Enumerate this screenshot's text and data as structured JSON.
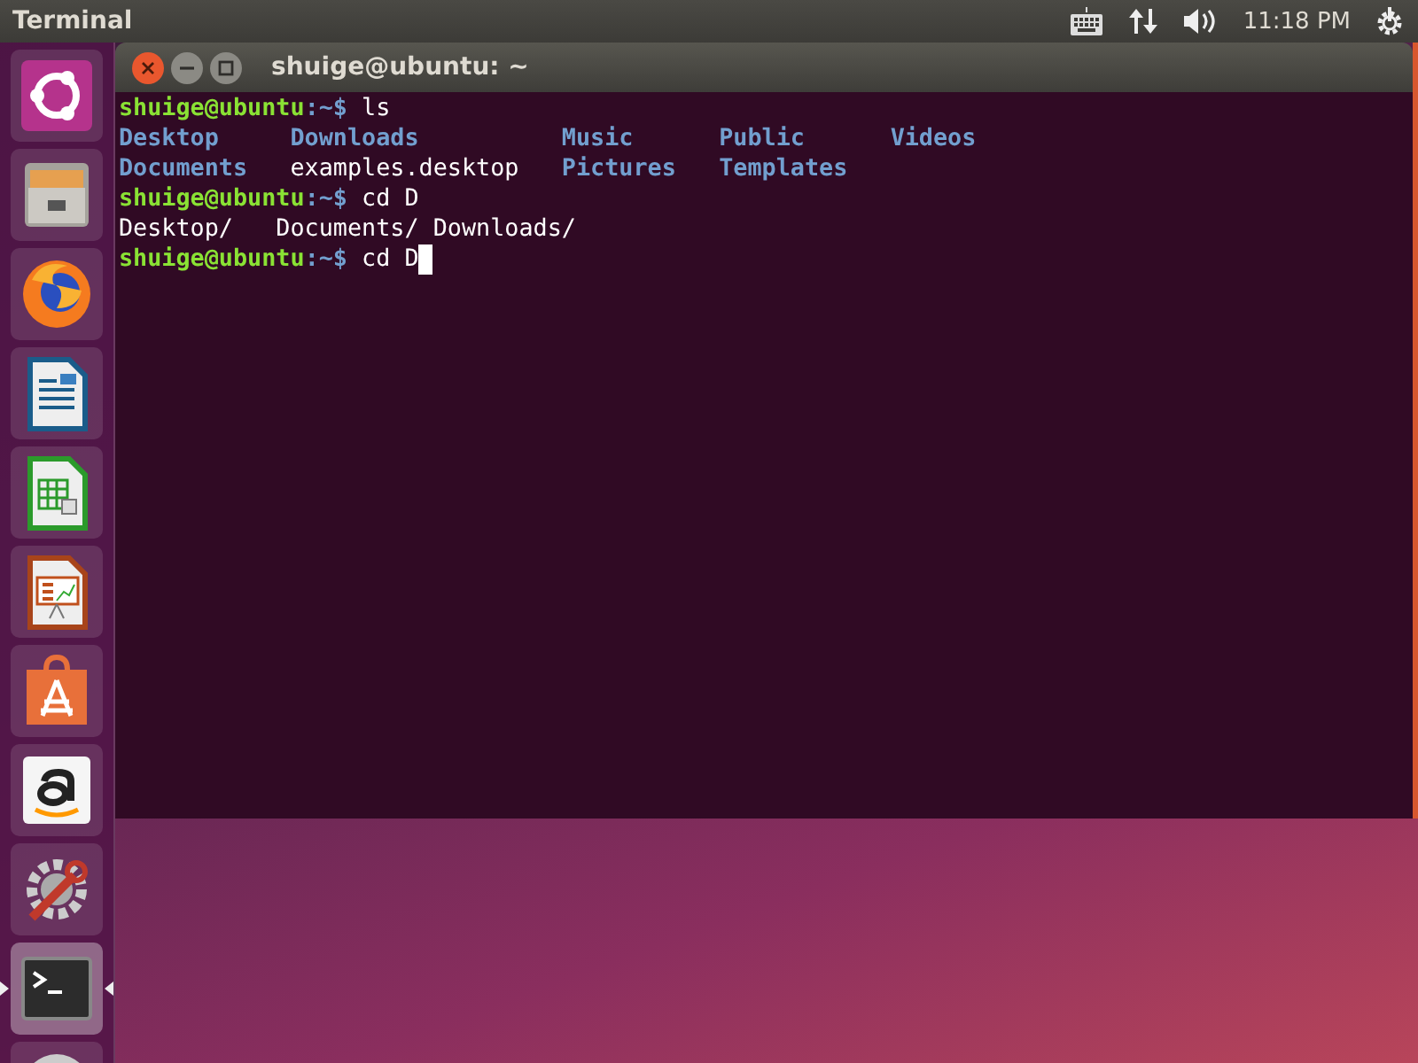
{
  "top_bar": {
    "app_title": "Terminal",
    "clock": "11:18 PM"
  },
  "launcher": {
    "items": [
      {
        "kind": "ubuntu",
        "active": false
      },
      {
        "kind": "files",
        "active": false
      },
      {
        "kind": "firefox",
        "active": false
      },
      {
        "kind": "writer",
        "active": false
      },
      {
        "kind": "calc",
        "active": false
      },
      {
        "kind": "impress",
        "active": false
      },
      {
        "kind": "store",
        "active": false
      },
      {
        "kind": "amazon",
        "active": false
      },
      {
        "kind": "settings",
        "active": false
      },
      {
        "kind": "terminal",
        "active": true
      },
      {
        "kind": "disc",
        "active": false
      }
    ]
  },
  "window": {
    "title": "shuige@ubuntu: ~",
    "lines": [
      {
        "kind": "prompt",
        "user": "shuige@ubuntu",
        "path": ":~$",
        "command": "ls",
        "cursor": false
      },
      {
        "kind": "listing",
        "entries": [
          {
            "name": "Desktop",
            "kind": "dir"
          },
          {
            "name": "Downloads",
            "kind": "dir"
          },
          {
            "name": "Music",
            "kind": "dir"
          },
          {
            "name": "Public",
            "kind": "dir"
          },
          {
            "name": "Videos",
            "kind": "dir"
          },
          {
            "name": "Documents",
            "kind": "dir"
          },
          {
            "name": "examples.desktop",
            "kind": "file"
          },
          {
            "name": "Pictures",
            "kind": "dir"
          },
          {
            "name": "Templates",
            "kind": "dir"
          }
        ]
      },
      {
        "kind": "prompt",
        "user": "shuige@ubuntu",
        "path": ":~$",
        "command": "cd D",
        "cursor": false
      },
      {
        "kind": "output",
        "text": "Desktop/   Documents/ Downloads/"
      },
      {
        "kind": "prompt",
        "user": "shuige@ubuntu",
        "path": ":~$",
        "command": "cd D",
        "cursor": true
      }
    ]
  }
}
